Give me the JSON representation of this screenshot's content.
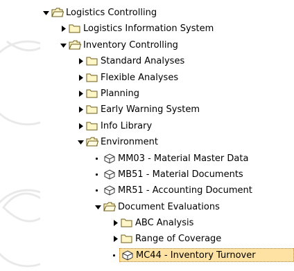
{
  "tree": {
    "nodes": [
      {
        "label": "Logistics Controlling",
        "type": "folder",
        "state": "open",
        "level": 0
      },
      {
        "label": "Logistics Information System",
        "type": "folder",
        "state": "closed",
        "level": 1
      },
      {
        "label": "Inventory Controlling",
        "type": "folder",
        "state": "open",
        "level": 1
      },
      {
        "label": "Standard Analyses",
        "type": "folder",
        "state": "closed",
        "level": 2
      },
      {
        "label": "Flexible Analyses",
        "type": "folder",
        "state": "closed",
        "level": 2
      },
      {
        "label": "Planning",
        "type": "folder",
        "state": "closed",
        "level": 2
      },
      {
        "label": "Early Warning System",
        "type": "folder",
        "state": "closed",
        "level": 2
      },
      {
        "label": "Info Library",
        "type": "folder",
        "state": "closed",
        "level": 2
      },
      {
        "label": "Environment",
        "type": "folder",
        "state": "open",
        "level": 2
      },
      {
        "label": "MM03 - Material Master Data",
        "type": "transaction",
        "level": 3
      },
      {
        "label": "MB51 - Material Documents",
        "type": "transaction",
        "level": 3
      },
      {
        "label": "MR51 - Accounting Document",
        "type": "transaction",
        "level": 3
      },
      {
        "label": "Document Evaluations",
        "type": "folder",
        "state": "open",
        "level": 3
      },
      {
        "label": "ABC Analysis",
        "type": "folder",
        "state": "closed",
        "level": 4
      },
      {
        "label": "Range of Coverage",
        "type": "folder",
        "state": "closed",
        "level": 4
      },
      {
        "label": "MC44 - Inventory Turnover",
        "type": "transaction",
        "level": 4,
        "selected": true
      }
    ]
  },
  "colors": {
    "folder_fill": "#fff6c8",
    "folder_stroke": "#6b5a1a",
    "selection_fill": "#fde2a3",
    "selection_border": "#d27b00",
    "watermark": "#e8e8e8"
  },
  "icons": {
    "folder": "folder-icon",
    "folder_open": "folder-open-icon",
    "transaction": "transaction-cube-icon",
    "expanded": "triangle-down-icon",
    "collapsed": "triangle-right-icon"
  }
}
